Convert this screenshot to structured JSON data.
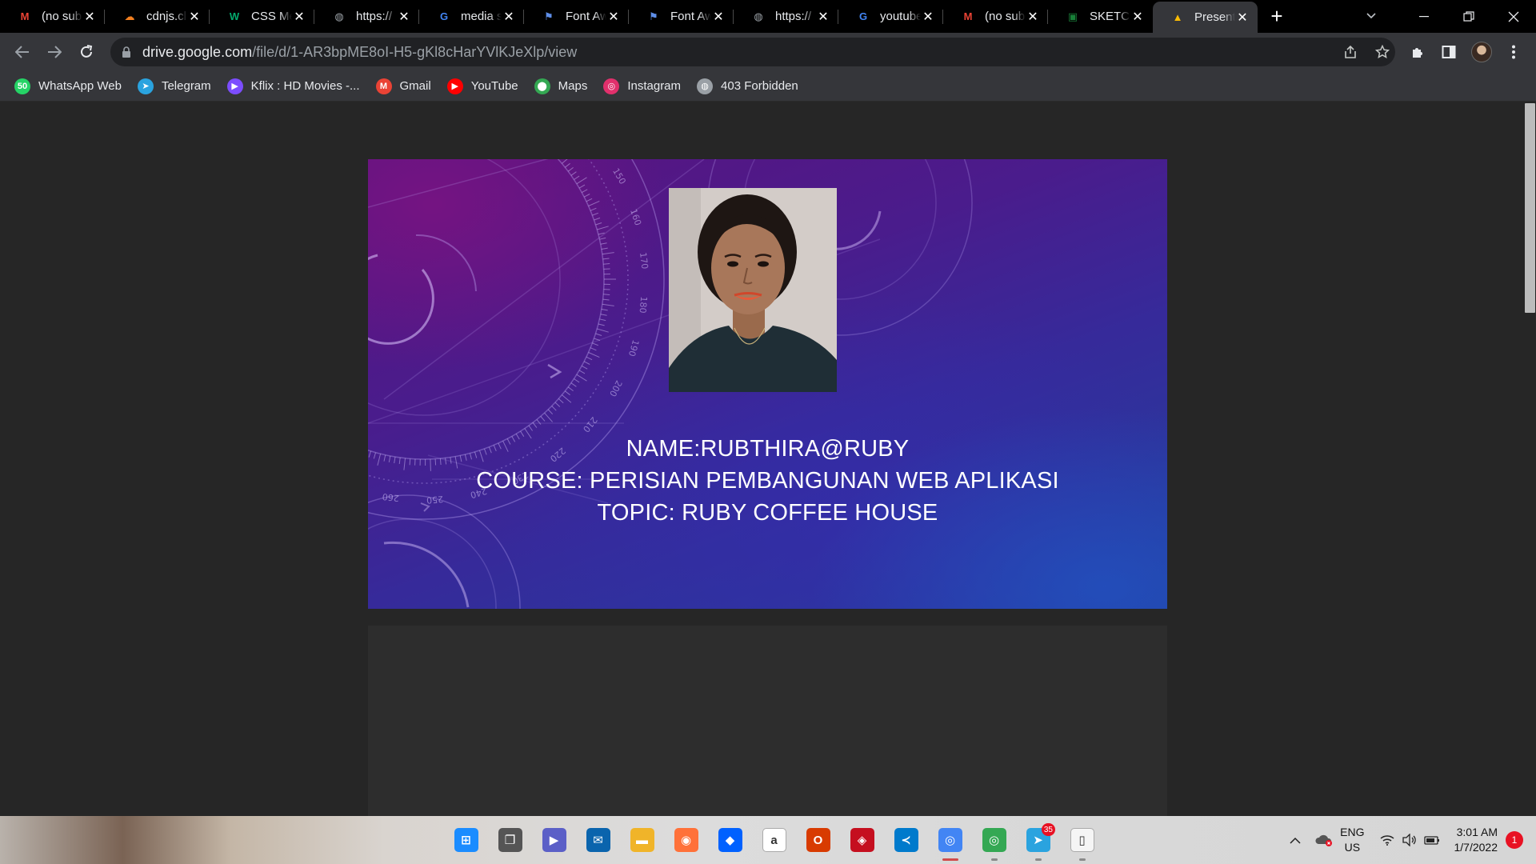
{
  "browser": {
    "tabs": [
      {
        "title": "(no sub",
        "icon": "gmail-icon",
        "color": "#ea4335",
        "glyph": "M"
      },
      {
        "title": "cdnjs.cl",
        "icon": "cloudflare-icon",
        "color": "#f38020",
        "glyph": "☁"
      },
      {
        "title": "CSS Me",
        "icon": "w3schools-icon",
        "color": "#04aa6d",
        "glyph": "W"
      },
      {
        "title": "https://",
        "icon": "globe-icon",
        "color": "#9aa0a6",
        "glyph": "◍"
      },
      {
        "title": "media s",
        "icon": "google-icon",
        "color": "#4285f4",
        "glyph": "G"
      },
      {
        "title": "Font Aw",
        "icon": "flag-icon",
        "color": "#5e8ee8",
        "glyph": "⚑"
      },
      {
        "title": "Font Aw",
        "icon": "flag-icon",
        "color": "#5e8ee8",
        "glyph": "⚑"
      },
      {
        "title": "https://",
        "icon": "globe-icon",
        "color": "#9aa0a6",
        "glyph": "◍"
      },
      {
        "title": "youtube",
        "icon": "google-icon",
        "color": "#4285f4",
        "glyph": "G"
      },
      {
        "title": "(no sub",
        "icon": "gmail-icon",
        "color": "#ea4335",
        "glyph": "M"
      },
      {
        "title": "SKETCH",
        "icon": "sheets-icon",
        "color": "#188038",
        "glyph": "▣"
      },
      {
        "title": "Present",
        "icon": "drive-icon",
        "color": "#fbbc04",
        "glyph": "▲",
        "active": true
      }
    ],
    "new_tab_label": "+",
    "url_host": "drive.google.com",
    "url_path": "/file/d/1-AR3bpME8oI-H5-gKl8cHarYVlKJeXlp/view",
    "bookmarks": [
      {
        "label": "WhatsApp Web",
        "icon": "whatsapp-icon",
        "color": "#25d366",
        "glyph": "50"
      },
      {
        "label": "Telegram",
        "icon": "telegram-icon",
        "color": "#2aa3df",
        "glyph": "➤"
      },
      {
        "label": "Kflix : HD Movies -...",
        "icon": "play-icon",
        "color": "#7c4dff",
        "glyph": "▶"
      },
      {
        "label": "Gmail",
        "icon": "gmail-icon",
        "color": "#ea4335",
        "glyph": "M"
      },
      {
        "label": "YouTube",
        "icon": "youtube-icon",
        "color": "#ff0000",
        "glyph": "▶"
      },
      {
        "label": "Maps",
        "icon": "maps-icon",
        "color": "#34a853",
        "glyph": "⬤"
      },
      {
        "label": "Instagram",
        "icon": "instagram-icon",
        "color": "#e1306c",
        "glyph": "◎"
      },
      {
        "label": "403 Forbidden",
        "icon": "globe-icon",
        "color": "#9aa0a6",
        "glyph": "◍"
      }
    ]
  },
  "slide": {
    "line1": "NAME:RUBTHIRA@RUBY",
    "line2": "COURSE: PERISIAN PEMBANGUNAN WEB APLIKASI",
    "line3": "TOPIC: RUBY COFFEE HOUSE",
    "dial_numbers": [
      "150",
      "160",
      "170",
      "180",
      "190",
      "200",
      "210",
      "220",
      "230",
      "240",
      "250",
      "260"
    ]
  },
  "taskbar": {
    "apps": [
      {
        "name": "start-button",
        "color": "#1a8cff",
        "glyph": "⊞"
      },
      {
        "name": "task-view-button",
        "color": "#555555",
        "glyph": "❐"
      },
      {
        "name": "teams-chat-button",
        "color": "#5b5fc7",
        "glyph": "▶"
      },
      {
        "name": "mail-app-button",
        "color": "#0a64ad",
        "glyph": "✉"
      },
      {
        "name": "file-explorer-button",
        "color": "#f0b429",
        "glyph": "▬"
      },
      {
        "name": "firefox-button",
        "color": "#ff7139",
        "glyph": "◉"
      },
      {
        "name": "dropbox-button",
        "color": "#0061ff",
        "glyph": "◆"
      },
      {
        "name": "amazon-button",
        "color": "#ffffff",
        "glyph": "a"
      },
      {
        "name": "office-button",
        "color": "#d83b01",
        "glyph": "O"
      },
      {
        "name": "app-red-button",
        "color": "#c50f1f",
        "glyph": "◈"
      },
      {
        "name": "vscode-button",
        "color": "#007acc",
        "glyph": "≺"
      },
      {
        "name": "chrome-button",
        "color": "#4285f4",
        "glyph": "◎",
        "running": "active"
      },
      {
        "name": "chrome-profile-button",
        "color": "#34a853",
        "glyph": "◎",
        "running": "yes"
      },
      {
        "name": "telegram-button",
        "color": "#2aa3df",
        "glyph": "➤",
        "running": "yes",
        "badge": "35"
      },
      {
        "name": "notepad-button",
        "color": "#f5f5f5",
        "glyph": "▯",
        "running": "yes"
      }
    ],
    "lang_top": "ENG",
    "lang_bottom": "US",
    "time": "3:01 AM",
    "date": "1/7/2022",
    "notification_count": "1"
  }
}
